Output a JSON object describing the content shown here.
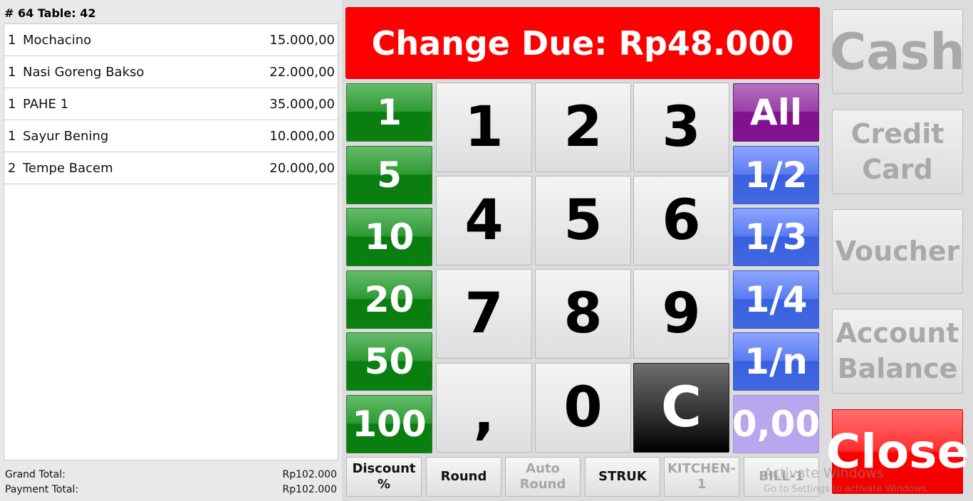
{
  "ticket": {
    "title": "# 64 Table: 42",
    "items": [
      {
        "qty": "1",
        "name": "Mochacino",
        "price": "15.000,00"
      },
      {
        "qty": "1",
        "name": "Nasi Goreng Bakso",
        "price": "22.000,00"
      },
      {
        "qty": "1",
        "name": "PAHE 1",
        "price": "35.000,00"
      },
      {
        "qty": "1",
        "name": "Sayur Bening",
        "price": "10.000,00"
      },
      {
        "qty": "2",
        "name": "Tempe Bacem",
        "price": "20.000,00"
      }
    ],
    "grand_total_label": "Grand Total:",
    "grand_total_value": "Rp102.000",
    "payment_total_label": "Payment Total:",
    "payment_total_value": "Rp102.000"
  },
  "change_due": "Change Due: Rp48.000",
  "quick_amounts": [
    "1",
    "5",
    "10",
    "20",
    "50",
    "100"
  ],
  "keypad": {
    "k1": "1",
    "k2": "2",
    "k3": "3",
    "k4": "4",
    "k5": "5",
    "k6": "6",
    "k7": "7",
    "k8": "8",
    "k9": "9",
    "comma": ",",
    "k0": "0",
    "clear": "C"
  },
  "splits": [
    "All",
    "1/2",
    "1/3",
    "1/4",
    "1/n",
    "0,00"
  ],
  "bottom_buttons": {
    "discount_line1": "Discount",
    "discount_line2": "%",
    "round": "Round",
    "auto_round_line1": "Auto",
    "auto_round_line2": "Round",
    "struk": "STRUK",
    "kitchen_line1": "KITCHEN-",
    "kitchen_line2": "1",
    "bill": "BILL-1"
  },
  "payment_methods": {
    "cash": "Cash",
    "credit_line1": "Credit",
    "credit_line2": "Card",
    "voucher": "Voucher",
    "account_line1": "Account",
    "account_line2": "Balance",
    "close": "Close"
  },
  "watermark": {
    "title": "Activate Windows",
    "subtitle": "Go to Settings to activate Windows."
  },
  "colors": {
    "change_due_bg": "#ff0000",
    "quick_green": "#0a800f",
    "split_blue": "#4169e1",
    "split_purple": "#82138f",
    "zero_lavender": "#b9a7ee",
    "close_red": "#ff0000"
  }
}
